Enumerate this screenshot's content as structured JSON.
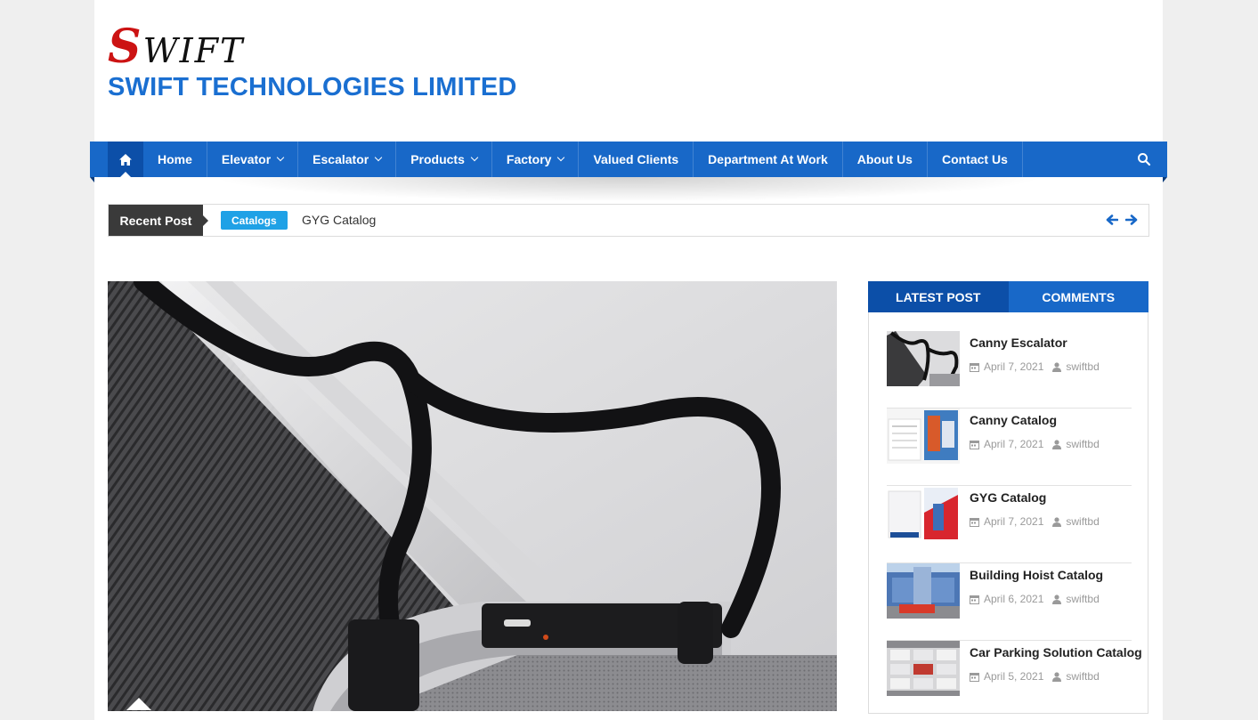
{
  "site": {
    "logo_text": "WIFT",
    "logo_initial": "S",
    "title": "SWIFT TECHNOLOGIES LIMITED"
  },
  "nav": {
    "home_icon": "home-icon",
    "items": [
      {
        "label": "Home",
        "has_dropdown": false
      },
      {
        "label": "Elevator",
        "has_dropdown": true
      },
      {
        "label": "Escalator",
        "has_dropdown": true
      },
      {
        "label": "Products",
        "has_dropdown": true
      },
      {
        "label": "Factory",
        "has_dropdown": true
      },
      {
        "label": "Valued Clients",
        "has_dropdown": false
      },
      {
        "label": "Department At Work",
        "has_dropdown": false
      },
      {
        "label": "About Us",
        "has_dropdown": false
      },
      {
        "label": "Contact Us",
        "has_dropdown": false
      }
    ],
    "search_icon": "search-icon"
  },
  "ticker": {
    "label": "Recent Post",
    "badge": "Catalogs",
    "text": "GYG Catalog"
  },
  "sidebar": {
    "tabs": [
      {
        "label": "LATEST POST",
        "active": true
      },
      {
        "label": "COMMENTS",
        "active": false
      }
    ],
    "posts": [
      {
        "title": "Canny Escalator",
        "date": "April 7, 2021",
        "author": "swiftbd"
      },
      {
        "title": "Canny Catalog",
        "date": "April 7, 2021",
        "author": "swiftbd"
      },
      {
        "title": "GYG Catalog",
        "date": "April 7, 2021",
        "author": "swiftbd"
      },
      {
        "title": "Building Hoist Catalog",
        "date": "April 6, 2021",
        "author": "swiftbd"
      },
      {
        "title": "Car Parking Solution Catalog",
        "date": "April 5, 2021",
        "author": "swiftbd"
      }
    ]
  },
  "colors": {
    "brand_blue": "#1868c8",
    "dark_blue": "#0c4fa8",
    "logo_red": "#cc1313",
    "badge_blue": "#1fa1e6"
  }
}
